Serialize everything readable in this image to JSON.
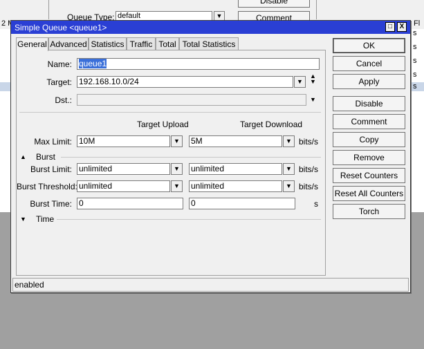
{
  "background": {
    "queue_type_label": "Queue Type:",
    "queue_type_value": "default",
    "top_buttons": [
      "Disable",
      "Comment"
    ],
    "left_header": "2 M",
    "right_header": "Fl",
    "right_col_values": [
      "s",
      "s",
      "s",
      "s",
      "s"
    ]
  },
  "window": {
    "title": "Simple Queue <queue1>",
    "maximize_glyph": "□",
    "close_glyph": "X"
  },
  "tabs": [
    "General",
    "Advanced",
    "Statistics",
    "Traffic",
    "Total",
    "Total Statistics"
  ],
  "form": {
    "name_label": "Name:",
    "name_value": "queue1",
    "target_label": "Target:",
    "target_value": "192.168.10.0/24",
    "dst_label": "Dst.:",
    "dst_value": "",
    "col_upload": "Target Upload",
    "col_download": "Target Download",
    "max_limit_label": "Max Limit:",
    "max_limit_upload": "10M",
    "max_limit_download": "5M",
    "unit_bits": "bits/s",
    "unit_s": "s",
    "burst_section": "Burst",
    "burst_limit_label": "Burst Limit:",
    "burst_limit_upload": "unlimited",
    "burst_limit_download": "unlimited",
    "burst_threshold_label": "Burst Threshold:",
    "burst_threshold_upload": "unlimited",
    "burst_threshold_download": "unlimited",
    "burst_time_label": "Burst Time:",
    "burst_time_upload": "0",
    "burst_time_download": "0",
    "time_section": "Time"
  },
  "buttons": [
    "OK",
    "Cancel",
    "Apply",
    "Disable",
    "Comment",
    "Copy",
    "Remove",
    "Reset Counters",
    "Reset All Counters",
    "Torch"
  ],
  "status": "enabled"
}
